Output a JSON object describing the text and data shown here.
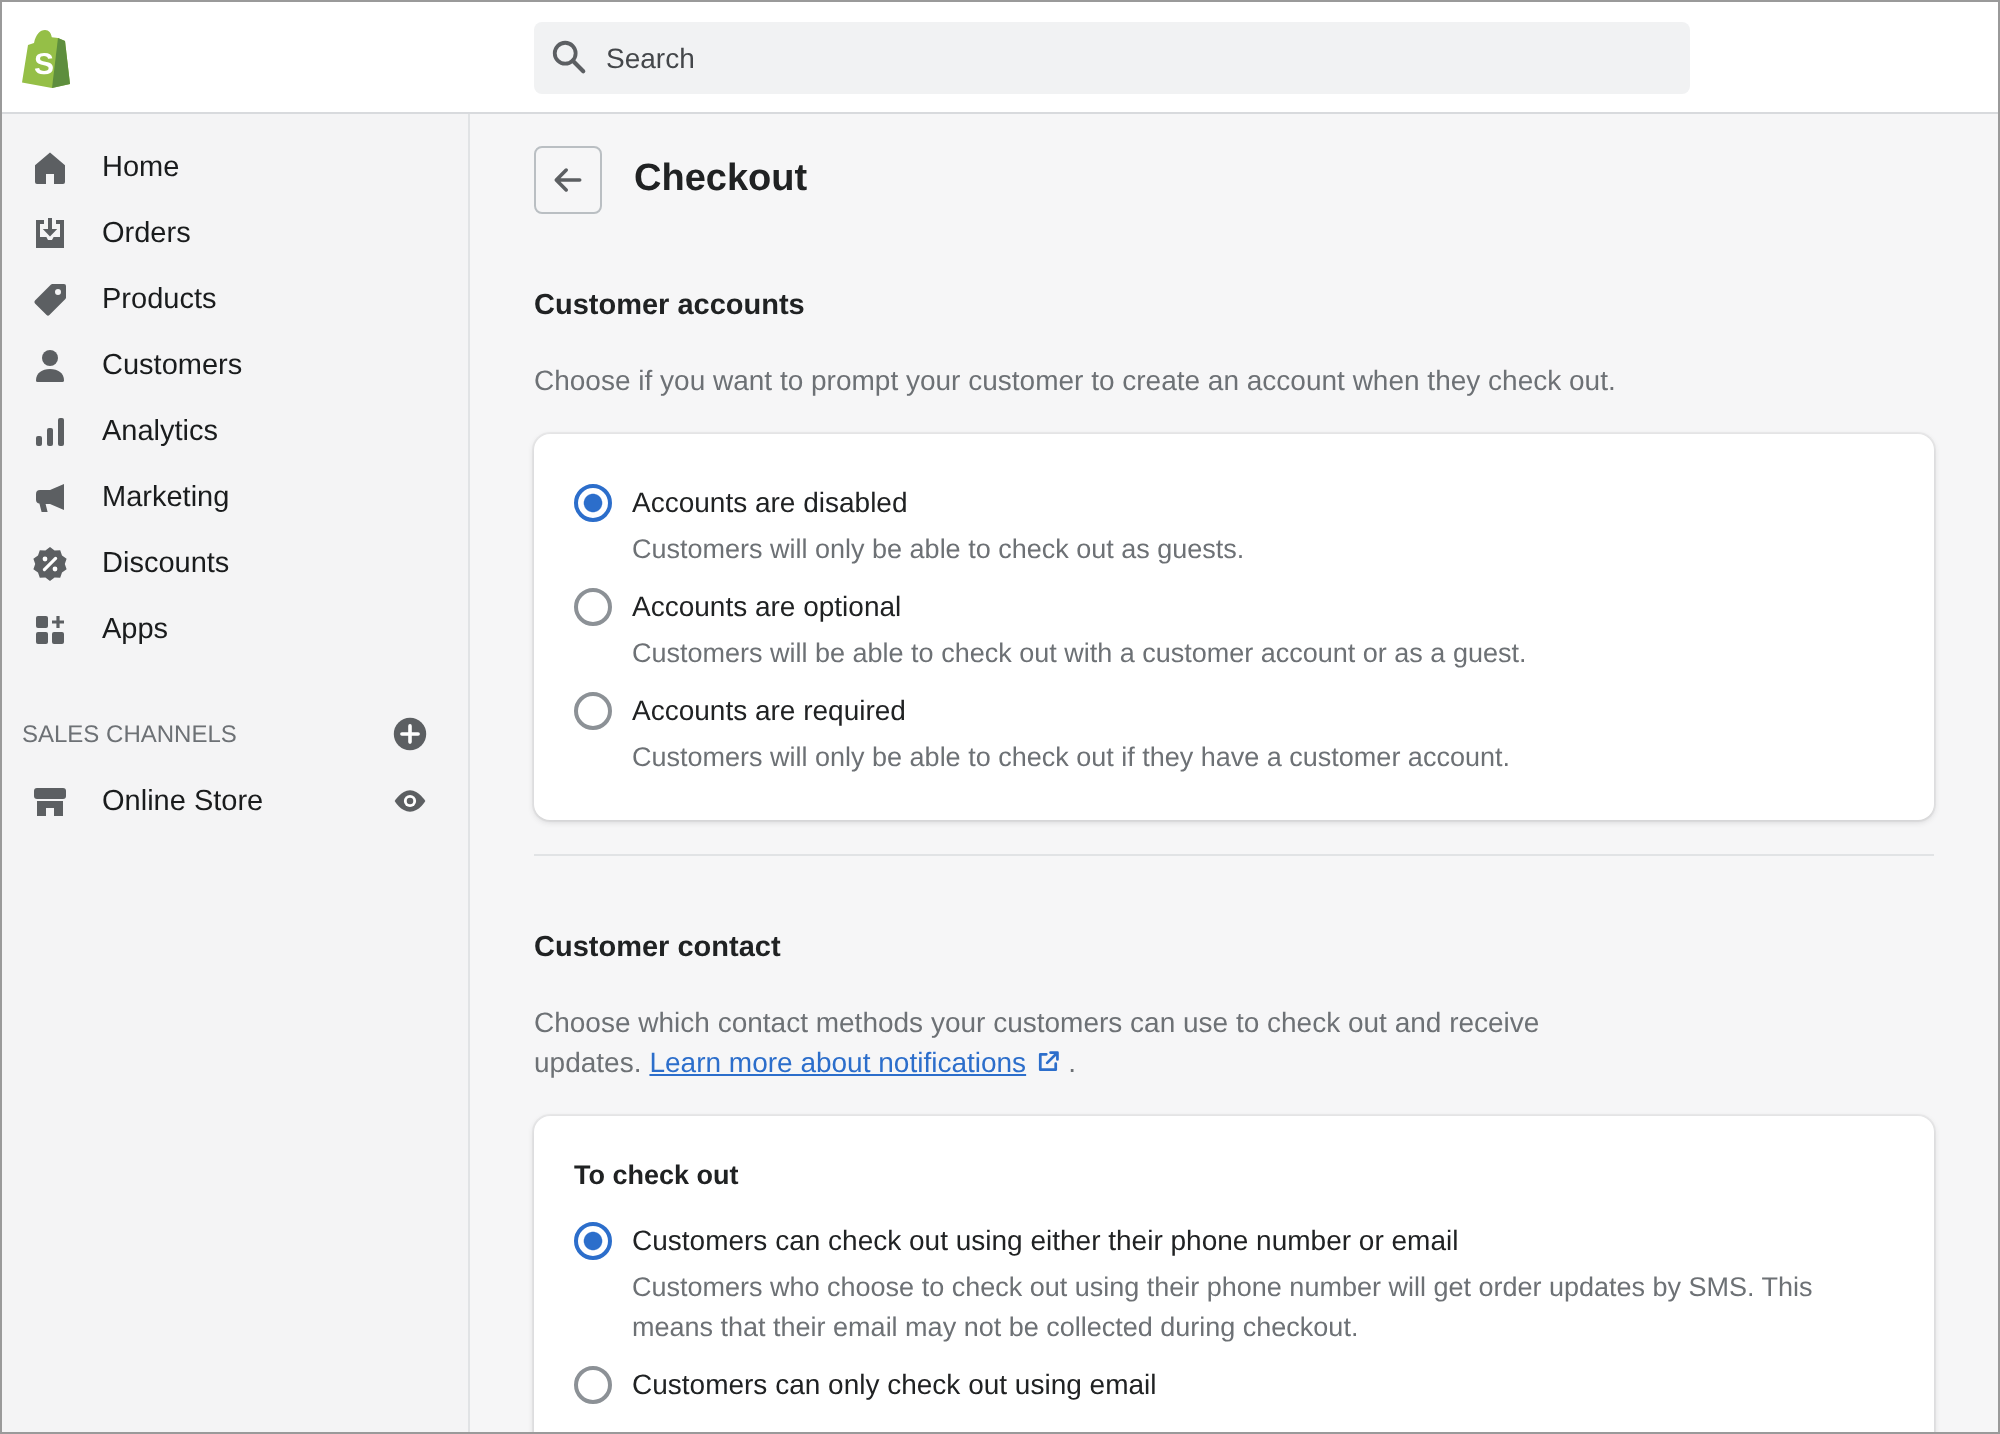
{
  "top_bar": {
    "logo": {
      "letter": "S"
    },
    "search": {
      "placeholder": "Search"
    }
  },
  "sidebar": {
    "items": [
      {
        "label": "Home",
        "selected": false
      },
      {
        "label": "Orders",
        "selected": false
      },
      {
        "label": "Products",
        "selected": false
      },
      {
        "label": "Customers",
        "selected": false
      },
      {
        "label": "Analytics",
        "selected": false
      },
      {
        "label": "Marketing",
        "selected": false
      },
      {
        "label": "Discounts",
        "selected": false
      },
      {
        "label": "Apps",
        "selected": false
      }
    ],
    "sales_channels": {
      "title": "SALES CHANNELS",
      "items": [
        {
          "label": "Online Store",
          "selected": false
        }
      ]
    }
  },
  "page": {
    "title": "Checkout",
    "sections": [
      {
        "heading": "Customer accounts",
        "description": "Choose if you want to prompt your customer to create an account when they check out.",
        "cards": [
          {
            "options": [
              {
                "label": "Accounts are disabled",
                "help": "Customers will only be able to check out as guests.",
                "selected": true
              },
              {
                "label": "Accounts are optional",
                "help": "Customers will be able to check out with a customer account or as a guest.",
                "selected": false
              },
              {
                "label": "Accounts are required",
                "help": "Customers will only be able to check out if they have a customer account.",
                "selected": false
              }
            ]
          }
        ]
      },
      {
        "heading": "Customer contact",
        "description": "Choose which contact methods your customers can use to check out and receive updates.",
        "link": "Learn more about notifications",
        "description_end": ".",
        "cards": [
          {
            "title": "To check out",
            "options": [
              {
                "label": "Customers can check out using either their phone number or email",
                "help": "Customers who choose to check out using their phone number will get order updates by SMS. This means that their email may not be collected during checkout.",
                "selected": true
              },
              {
                "label": "Customers can only check out using email",
                "selected": false
              }
            ]
          }
        ]
      }
    ]
  }
}
